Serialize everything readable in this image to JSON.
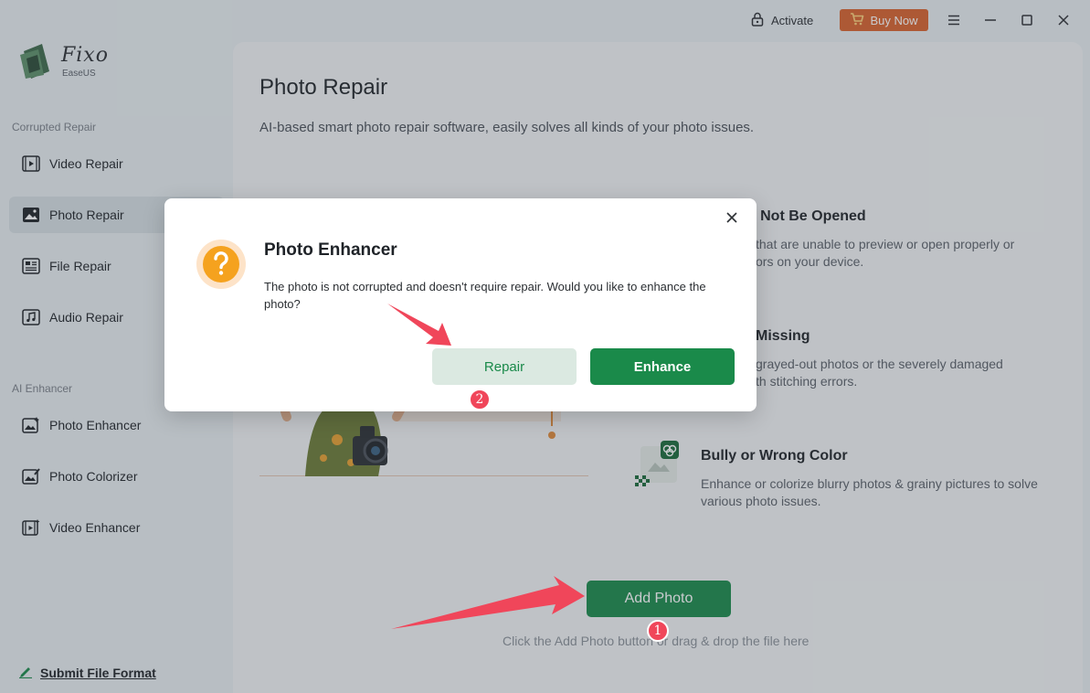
{
  "window": {
    "activate_label": "Activate",
    "buy_now_label": "Buy Now",
    "accent_color": "#1a8a4a",
    "buy_color": "#d9622b"
  },
  "sidebar": {
    "logo_name": "Fixo",
    "logo_sub": "EaseUS",
    "section_corrupted": "Corrupted Repair",
    "corrupted_items": [
      {
        "label": "Video Repair",
        "icon": "video-icon"
      },
      {
        "label": "Photo Repair",
        "icon": "photo-icon",
        "active": true
      },
      {
        "label": "File Repair",
        "icon": "file-icon"
      },
      {
        "label": "Audio Repair",
        "icon": "audio-icon"
      }
    ],
    "section_ai": "AI Enhancer",
    "ai_items": [
      {
        "label": "Photo Enhancer",
        "icon": "photo-enhancer-icon"
      },
      {
        "label": "Photo Colorizer",
        "icon": "photo-colorizer-icon"
      },
      {
        "label": "Video Enhancer",
        "icon": "video-enhancer-icon"
      }
    ],
    "submit_label": "Submit File Format"
  },
  "main": {
    "title": "Photo Repair",
    "description": "AI-based smart photo repair software, easily solves all kinds of your photo issues.",
    "features": [
      {
        "title": "an Not Be Opened",
        "desc": "that are unable to preview or open properly or\nors on your device."
      },
      {
        "title": "Missing",
        "desc": "grayed-out photos or the severely damaged\nth stitching errors."
      },
      {
        "title": "Bully or Wrong Color",
        "desc": "Enhance or colorize blurry photos & grainy pictures to solve various photo issues."
      }
    ],
    "add_photo_label": "Add Photo",
    "drop_hint": "Click the Add Photo button or drag & drop the file here"
  },
  "dialog": {
    "title": "Photo Enhancer",
    "message": "The photo is not corrupted and doesn't require repair. Would you like to enhance the photo?",
    "repair_label": "Repair",
    "enhance_label": "Enhance"
  },
  "annotations": {
    "badge_1": "1",
    "badge_2": "2"
  }
}
